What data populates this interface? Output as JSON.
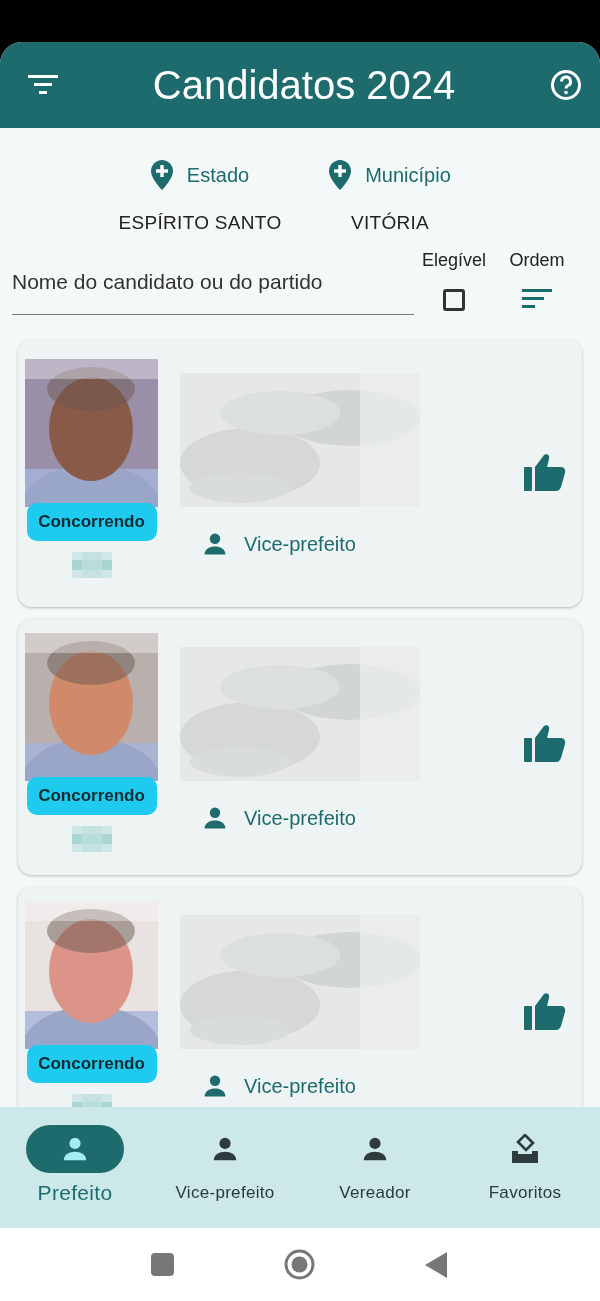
{
  "app_bar": {
    "title": "Candidatos 2024"
  },
  "location": [
    {
      "label": "Estado",
      "value": "ESPÍRITO SANTO"
    },
    {
      "label": "Município",
      "value": "VITÓRIA"
    }
  ],
  "search": {
    "placeholder": "Nome do candidato ou do partido"
  },
  "eligible": {
    "label": "Elegível",
    "checked": false
  },
  "order": {
    "label": "Ordem"
  },
  "candidates": [
    {
      "status": "Concorrendo",
      "role": "Vice-prefeito"
    },
    {
      "status": "Concorrendo",
      "role": "Vice-prefeito"
    },
    {
      "status": "Concorrendo",
      "role": "Vice-prefeito"
    }
  ],
  "bottom_nav": [
    {
      "label": "Prefeito",
      "selected": true
    },
    {
      "label": "Vice-prefeito",
      "selected": false
    },
    {
      "label": "Vereador",
      "selected": false
    },
    {
      "label": "Favoritos",
      "selected": false
    }
  ]
}
